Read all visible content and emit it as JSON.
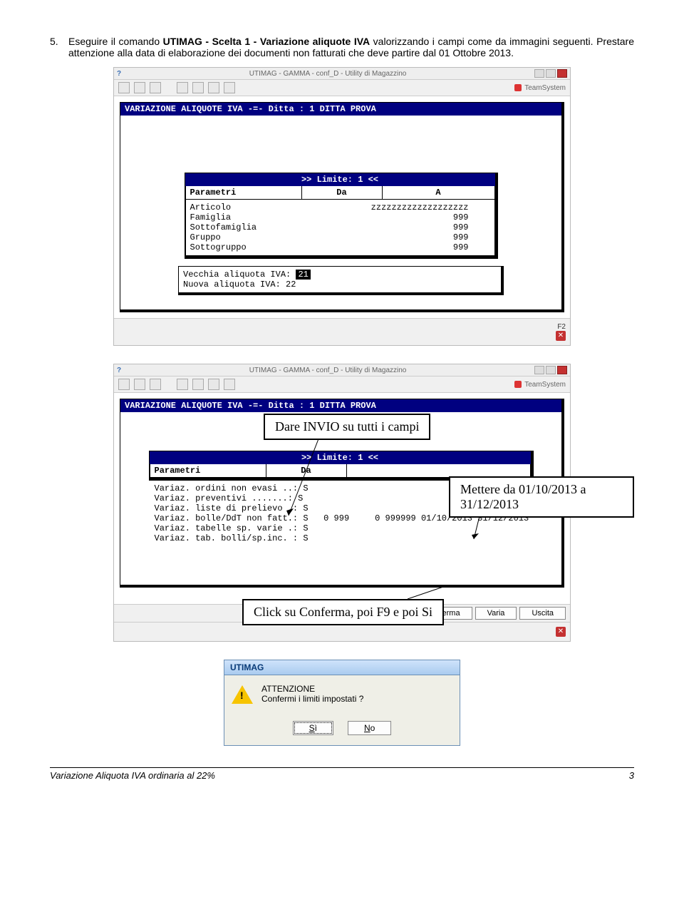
{
  "instruction": {
    "number": "5.",
    "pre": "Eseguire il comando ",
    "cmd": "UTIMAG - Scelta 1 - Variazione aliquote IVA",
    "post": " valorizzando i campi come da immagini seguenti. Prestare attenzione alla data di elaborazione dei documenti non fatturati che deve partire dal 01 Ottobre 2013."
  },
  "window": {
    "title": "UTIMAG - GAMMA - conf_D - Utility di Magazzino",
    "brand": "TeamSystem",
    "header_bar": "VARIAZIONE ALIQUOTE IVA -=- Ditta :   1 DITTA PROVA",
    "limite_bar": ">> Limite:   1 <<",
    "params_head": {
      "p": "Parametri",
      "da": "Da",
      "a": "A"
    },
    "params": [
      {
        "label": "Articolo",
        "value": "zzzzzzzzzzzzzzzzzzz"
      },
      {
        "label": "Famiglia",
        "value": "999"
      },
      {
        "label": "Sottofamiglia",
        "value": "999"
      },
      {
        "label": "Gruppo",
        "value": "999"
      },
      {
        "label": "Sottogruppo",
        "value": "999"
      }
    ],
    "aliquota": {
      "old_label": "Vecchia aliquota IVA:",
      "old_value": "21",
      "new_label": "Nuova  aliquota  IVA:",
      "new_value": "22"
    },
    "f2": "F2"
  },
  "window2": {
    "callout_invio": "Dare INVIO su tutti i campi",
    "callout_date": "Mettere da 01/10/2013 a 31/12/2013",
    "callout_conferma": "Click su Conferma, poi F9 e poi Si",
    "variaz": {
      "r1": "Variaz. ordini non evasi ..: S",
      "r2": "Variaz. preventivi .......: S",
      "r3": "Variaz. liste di prelievo .: S",
      "r4": "Variaz. bolle/DdT non fatt.: S   0 999     0 999999 01/10/2013 31/12/2013",
      "r5": "Variaz. tabelle sp. varie .: S",
      "r6": "Variaz. tab. bolli/sp.inc. : S"
    },
    "buttons": {
      "conferma": "Conferma",
      "varia": "Varia",
      "uscita": "Uscita"
    }
  },
  "dialog": {
    "title": "UTIMAG",
    "line1": "ATTENZIONE",
    "line2": "Confermi i limiti impostati ?",
    "yes": "Sì",
    "no": "No"
  },
  "footer": {
    "left": "Variazione Aliquota IVA ordinaria al 22%",
    "right": "3"
  }
}
